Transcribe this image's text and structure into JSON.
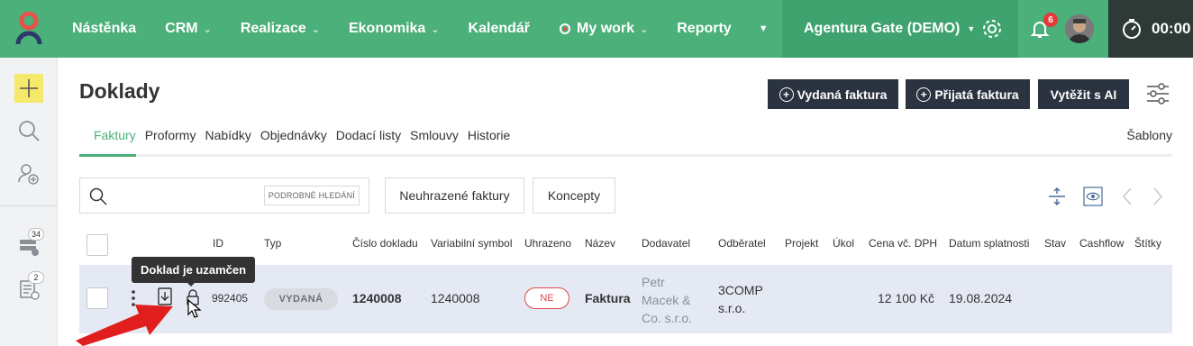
{
  "topbar": {
    "nav": [
      {
        "label": "Nástěnka",
        "dropdown": false
      },
      {
        "label": "CRM",
        "dropdown": true
      },
      {
        "label": "Realizace",
        "dropdown": true
      },
      {
        "label": "Ekonomika",
        "dropdown": true
      },
      {
        "label": "Kalendář",
        "dropdown": false
      },
      {
        "label": "My work",
        "dropdown": true
      },
      {
        "label": "Reporty",
        "dropdown": false
      }
    ],
    "company": "Agentura Gate (DEMO)",
    "notification_count": "6",
    "timer": "00:00",
    "colors": {
      "bar": "#4bb07a",
      "timer_bg": "#2d3a36"
    }
  },
  "sidebar": {
    "badge_top": "34",
    "badge_bottom": "2"
  },
  "page": {
    "title": "Doklady",
    "buttons": {
      "issued_invoice": "Vydaná faktura",
      "received_invoice": "Přijatá faktura",
      "extract_ai": "Vytěžit s AI"
    },
    "tabs": [
      "Faktury",
      "Proformy",
      "Nabídky",
      "Objednávky",
      "Dodací listy",
      "Smlouvy",
      "Historie"
    ],
    "active_tab": "Faktury",
    "templates_link": "Šablony",
    "search": {
      "placeholder": "",
      "advanced_label": "PODROBNÉ HLEDÁNÍ"
    },
    "filters": {
      "unpaid": "Neuhrazené faktury",
      "drafts": "Koncepty"
    }
  },
  "table": {
    "columns": [
      "ID",
      "Typ",
      "Číslo dokladu",
      "Variabilní symbol",
      "Uhrazeno",
      "Název",
      "Dodavatel",
      "Odběratel",
      "Projekt",
      "Úkol",
      "Cena vč. DPH",
      "Datum splatnosti",
      "Stav",
      "Cashflow",
      "Štítky"
    ],
    "rows": [
      {
        "id": "992405",
        "type": "VYDANÁ",
        "number": "1240008",
        "variable_symbol": "1240008",
        "paid": "NE",
        "name": "Faktura",
        "supplier_lines": [
          "Petr",
          "Macek &",
          "Co. s.r.o."
        ],
        "customer_lines": [
          "3COMP",
          "s.r.o."
        ],
        "project": "",
        "task": "",
        "price": "12 100 Kč",
        "due_date": "19.08.2024",
        "status": "",
        "cashflow": "",
        "tags": ""
      }
    ]
  },
  "tooltip": "Doklad je uzamčen"
}
